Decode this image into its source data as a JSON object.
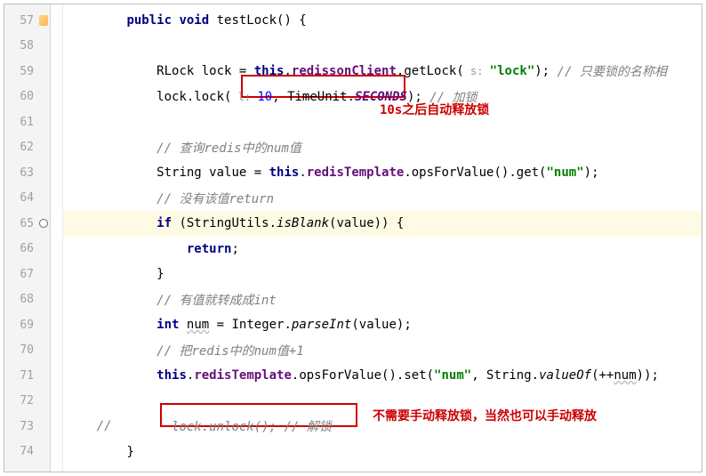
{
  "gutter": {
    "start": 57,
    "end": 74
  },
  "code": {
    "l57": {
      "indent": "        ",
      "kw1": "public void",
      "method": " testLock() {"
    },
    "l58": "",
    "l59": {
      "indent": "            ",
      "t1": "RLock lock = ",
      "kw": "this",
      "t2": ".",
      "fld": "redissonClient",
      "t3": ".getLock(",
      "hint": " s: ",
      "str": "\"lock\"",
      "t4": "); ",
      "cmt": "// 只要锁的名称相"
    },
    "l60": {
      "indent": "            ",
      "t1": "lock.lock(",
      "hint": " l: ",
      "num": "10",
      "t2": ", TimeUnit.",
      "sf": "SECONDS",
      "t3": "); ",
      "cmt": "// 加锁"
    },
    "l61": "",
    "l62": {
      "indent": "            ",
      "cmt": "// 查询redis中的num值"
    },
    "l63": {
      "indent": "            ",
      "t1": "String value = ",
      "kw": "this",
      "t2": ".",
      "fld": "redisTemplate",
      "t3": ".opsForValue().get(",
      "str": "\"num\"",
      "t4": ");"
    },
    "l64": {
      "indent": "            ",
      "cmt": "// 没有该值return"
    },
    "l65": {
      "indent": "            ",
      "kw1": "if",
      "t1": " (StringUtils.",
      "sm": "isBlank",
      "t2": "(value)) {"
    },
    "l66": {
      "indent": "                ",
      "kw": "return",
      "t": ";"
    },
    "l67": {
      "indent": "            ",
      "t": "}"
    },
    "l68": {
      "indent": "            ",
      "cmt": "// 有值就转成成int"
    },
    "l69": {
      "indent": "            ",
      "kw1": "int",
      "t1": " ",
      "var": "num",
      "t2": " = Integer.",
      "sm": "parseInt",
      "t3": "(value);"
    },
    "l70": {
      "indent": "            ",
      "cmt": "// 把redis中的num值+1"
    },
    "l71": {
      "indent": "            ",
      "kw": "this",
      "t1": ".",
      "fld": "redisTemplate",
      "t2": ".opsForValue().set(",
      "str": "\"num\"",
      "t3": ", String.",
      "sm": "valueOf",
      "t4": "(++",
      "var": "num",
      "t5": "));"
    },
    "l72": "",
    "l73": {
      "indent": "    ",
      "cc": "//        ",
      "cmt": "lock.unlock(); // 解锁"
    },
    "l74": {
      "indent": "        ",
      "t": "}"
    }
  },
  "annotations": {
    "box1_label": "10s之后自动释放锁",
    "box2_label": "不需要手动释放锁，当然也可以手动释放"
  }
}
